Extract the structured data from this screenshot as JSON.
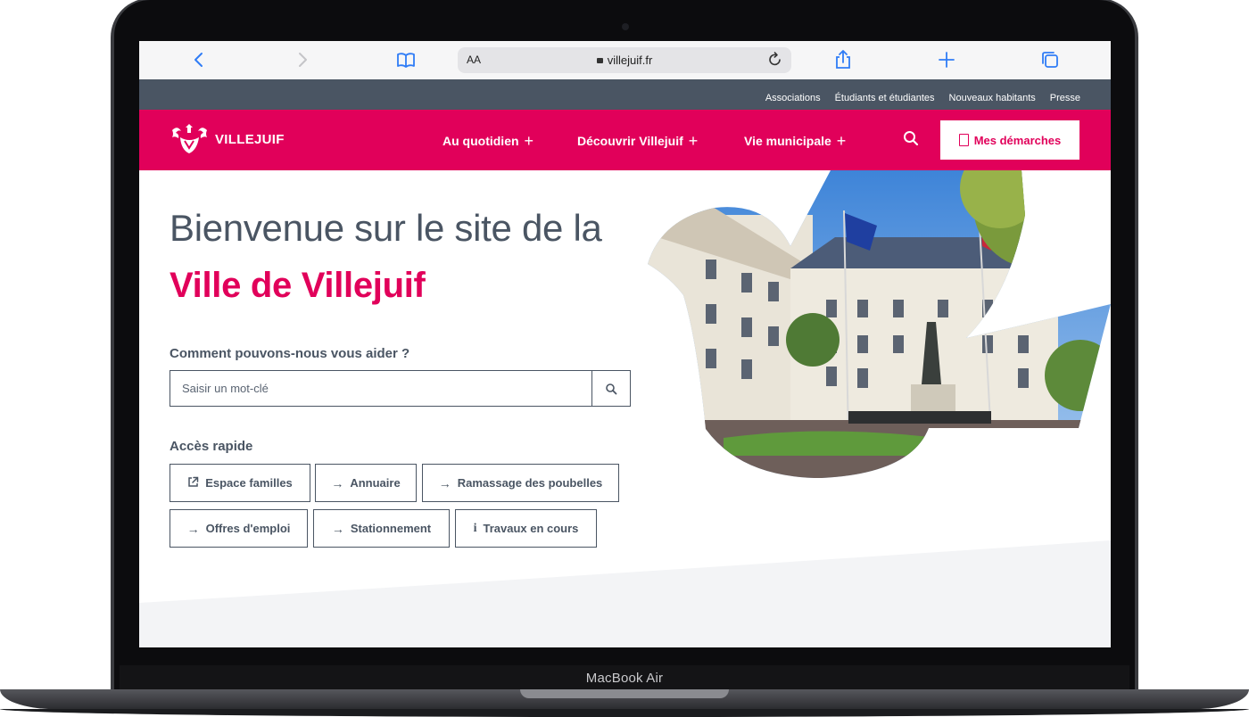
{
  "device": {
    "label": "MacBook Air"
  },
  "browser": {
    "url": "villejuif.fr",
    "aa": "AA",
    "icons": [
      "chevron-left-icon",
      "chevron-right-icon",
      "bookmarks-icon",
      "reload-icon",
      "share-icon",
      "plus-icon",
      "tabs-icon"
    ]
  },
  "utility_nav": [
    "Associations",
    "Étudiants et étudiantes",
    "Nouveaux habitants",
    "Presse"
  ],
  "header": {
    "logo_text": "VILLEJUIF",
    "nav": [
      "Au quotidien",
      "Découvrir Villejuif",
      "Vie municipale"
    ],
    "cta_label": "Mes démarches"
  },
  "hero": {
    "title_line1": "Bienvenue sur le site de la",
    "title_line2": "Ville de Villejuif"
  },
  "search": {
    "label": "Comment pouvons-nous vous aider ?",
    "placeholder": "Saisir un mot-clé"
  },
  "quick_access": {
    "label": "Accès rapide",
    "items": [
      {
        "icon": "external-link-icon",
        "label": "Espace familles"
      },
      {
        "icon": "arrow-right-icon",
        "label": "Annuaire"
      },
      {
        "icon": "arrow-right-icon",
        "label": "Ramassage des poubelles"
      },
      {
        "icon": "arrow-right-icon",
        "label": "Offres d'emploi"
      },
      {
        "icon": "arrow-right-icon",
        "label": "Stationnement"
      },
      {
        "icon": "info-icon",
        "label": "Travaux en cours"
      }
    ]
  },
  "colors": {
    "brand": "#e1005a",
    "dark": "#4a5563",
    "link_blue": "#2f7cf6"
  }
}
